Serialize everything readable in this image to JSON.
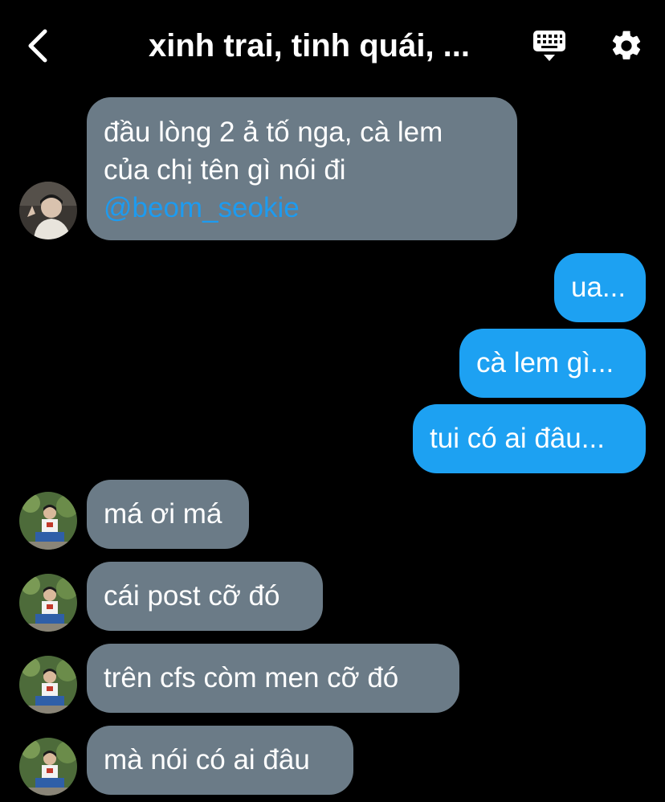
{
  "header": {
    "title": "xinh trai, tinh quái, ...",
    "back_icon": "chevron-left-icon",
    "keyboard_icon": "keyboard-icon",
    "settings_icon": "gear-icon"
  },
  "colors": {
    "background": "#000000",
    "incoming_bubble": "#6b7b87",
    "outgoing_bubble": "#1da1f2",
    "mention": "#1d9bf0"
  },
  "messages": [
    {
      "direction": "incoming",
      "lines": [
        "đầu lòng 2 ả tố nga, cà lem",
        "của chị tên gì nói đi"
      ],
      "mention": "@beom_seokie"
    },
    {
      "direction": "outgoing",
      "text": "ua..."
    },
    {
      "direction": "outgoing",
      "text": "cà lem gì..."
    },
    {
      "direction": "outgoing",
      "text": "tui có ai đâu..."
    },
    {
      "direction": "incoming",
      "text": "má ơi má"
    },
    {
      "direction": "incoming",
      "text": "cái post cỡ đó"
    },
    {
      "direction": "incoming",
      "text": "trên cfs còm men cỡ đó"
    },
    {
      "direction": "incoming",
      "text": "mà nói có ai đâu"
    }
  ]
}
